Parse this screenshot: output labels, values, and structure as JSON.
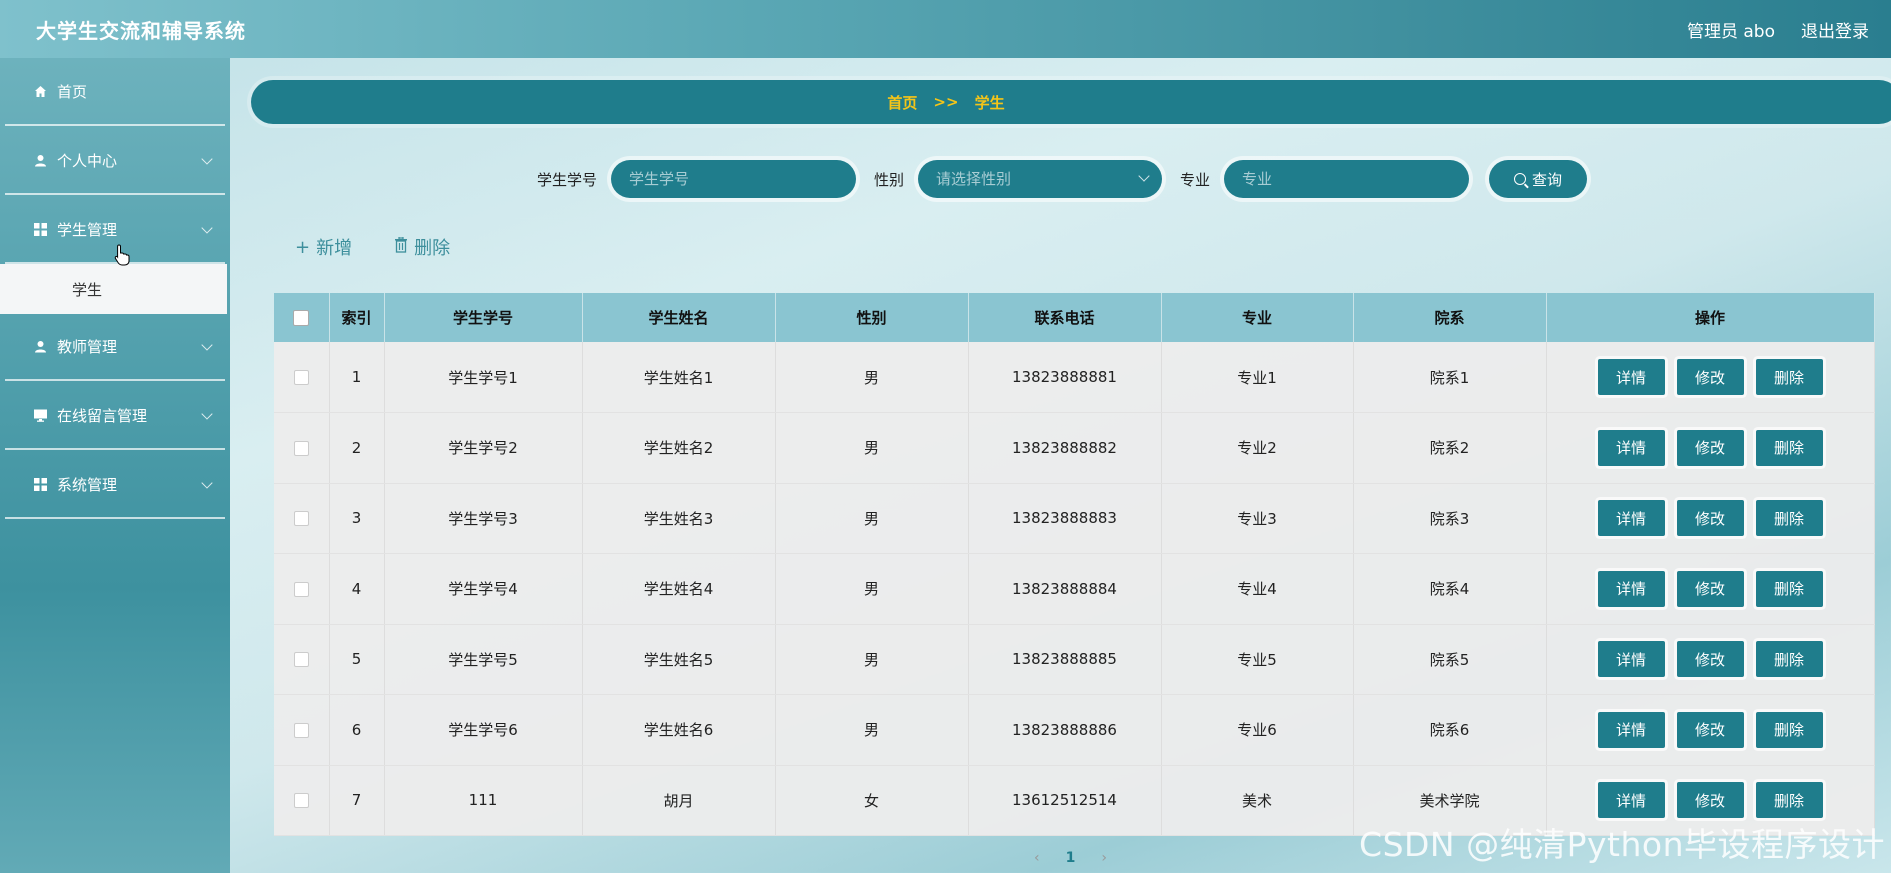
{
  "app": {
    "title": "大学生交流和辅导系统"
  },
  "header": {
    "user": "管理员 abo",
    "logout": "退出登录"
  },
  "sidebar": {
    "items": [
      {
        "label": "首页",
        "icon": "home-icon",
        "has_children": false
      },
      {
        "label": "个人中心",
        "icon": "user-icon",
        "has_children": true
      },
      {
        "label": "学生管理",
        "icon": "grid-icon",
        "has_children": true
      },
      {
        "label": "教师管理",
        "icon": "user-icon",
        "has_children": true
      },
      {
        "label": "在线留言管理",
        "icon": "monitor-icon",
        "has_children": true
      },
      {
        "label": "系统管理",
        "icon": "grid-icon",
        "has_children": true
      }
    ],
    "submenu": {
      "label": "学生"
    }
  },
  "breadcrumb": {
    "home": "首页",
    "sep": ">>",
    "current": "学生"
  },
  "search": {
    "student_no_label": "学生学号",
    "student_no_placeholder": "学生学号",
    "gender_label": "性别",
    "gender_placeholder": "请选择性别",
    "major_label": "专业",
    "major_placeholder": "专业",
    "query_label": "查询"
  },
  "toolbar": {
    "add_label": "新增",
    "delete_label": "删除"
  },
  "table": {
    "columns": [
      "索引",
      "学生学号",
      "学生姓名",
      "性别",
      "联系电话",
      "专业",
      "院系",
      "操作"
    ],
    "rows": [
      {
        "index": "1",
        "student_no": "学生学号1",
        "name": "学生姓名1",
        "gender": "男",
        "phone": "13823888881",
        "major": "专业1",
        "dept": "院系1"
      },
      {
        "index": "2",
        "student_no": "学生学号2",
        "name": "学生姓名2",
        "gender": "男",
        "phone": "13823888882",
        "major": "专业2",
        "dept": "院系2"
      },
      {
        "index": "3",
        "student_no": "学生学号3",
        "name": "学生姓名3",
        "gender": "男",
        "phone": "13823888883",
        "major": "专业3",
        "dept": "院系3"
      },
      {
        "index": "4",
        "student_no": "学生学号4",
        "name": "学生姓名4",
        "gender": "男",
        "phone": "13823888884",
        "major": "专业4",
        "dept": "院系4"
      },
      {
        "index": "5",
        "student_no": "学生学号5",
        "name": "学生姓名5",
        "gender": "男",
        "phone": "13823888885",
        "major": "专业5",
        "dept": "院系5"
      },
      {
        "index": "6",
        "student_no": "学生学号6",
        "name": "学生姓名6",
        "gender": "男",
        "phone": "13823888886",
        "major": "专业6",
        "dept": "院系6"
      },
      {
        "index": "7",
        "student_no": "111",
        "name": "胡月",
        "gender": "女",
        "phone": "13612512514",
        "major": "美术",
        "dept": "美术学院"
      }
    ],
    "actions": {
      "detail": "详情",
      "edit": "修改",
      "delete": "删除"
    }
  },
  "pagination": {
    "prev": "‹",
    "current": "1",
    "next": "›"
  },
  "watermark": "CSDN @纯清Python毕设程序设计",
  "colors": {
    "primary": "#1f7d8c",
    "header_cell": "#8ac5d1",
    "crumb": "#f5c518"
  }
}
